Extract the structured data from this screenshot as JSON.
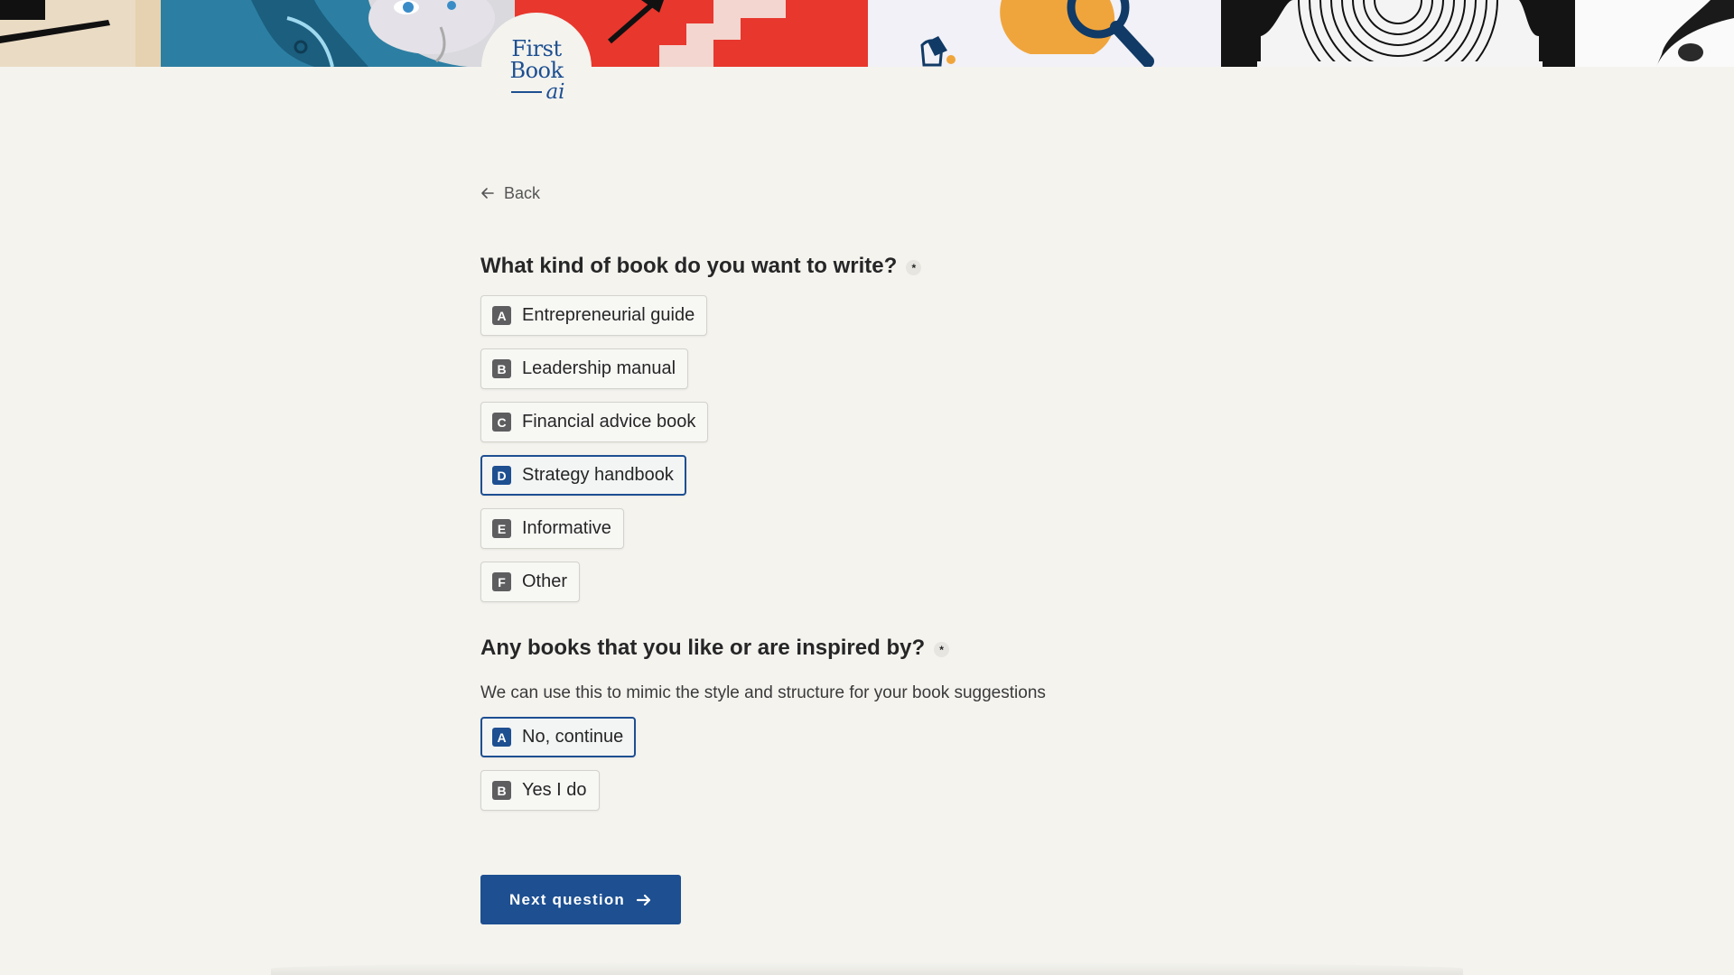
{
  "logo": {
    "line1": "First",
    "line2": "Book",
    "line3": "ai"
  },
  "back_label": "Back",
  "question1": {
    "title": "What kind of book do you want to write?",
    "required_mark": "*",
    "options": [
      {
        "key": "A",
        "label": "Entrepreneurial guide",
        "selected": false
      },
      {
        "key": "B",
        "label": "Leadership manual",
        "selected": false
      },
      {
        "key": "C",
        "label": "Financial advice book",
        "selected": false
      },
      {
        "key": "D",
        "label": "Strategy handbook",
        "selected": true
      },
      {
        "key": "E",
        "label": "Informative",
        "selected": false
      },
      {
        "key": "F",
        "label": "Other",
        "selected": false
      }
    ]
  },
  "question2": {
    "title": "Any books that you like or are inspired by?",
    "required_mark": "*",
    "subtext": "We can use this to mimic the style and structure for your book suggestions",
    "options": [
      {
        "key": "A",
        "label": "No, continue",
        "selected": true
      },
      {
        "key": "B",
        "label": "Yes I do",
        "selected": false
      }
    ]
  },
  "next_button": {
    "label": "Next question"
  },
  "colors": {
    "accent": "#1d4f91",
    "background": "#f4f3ee",
    "key_badge": "#5e5e60"
  }
}
